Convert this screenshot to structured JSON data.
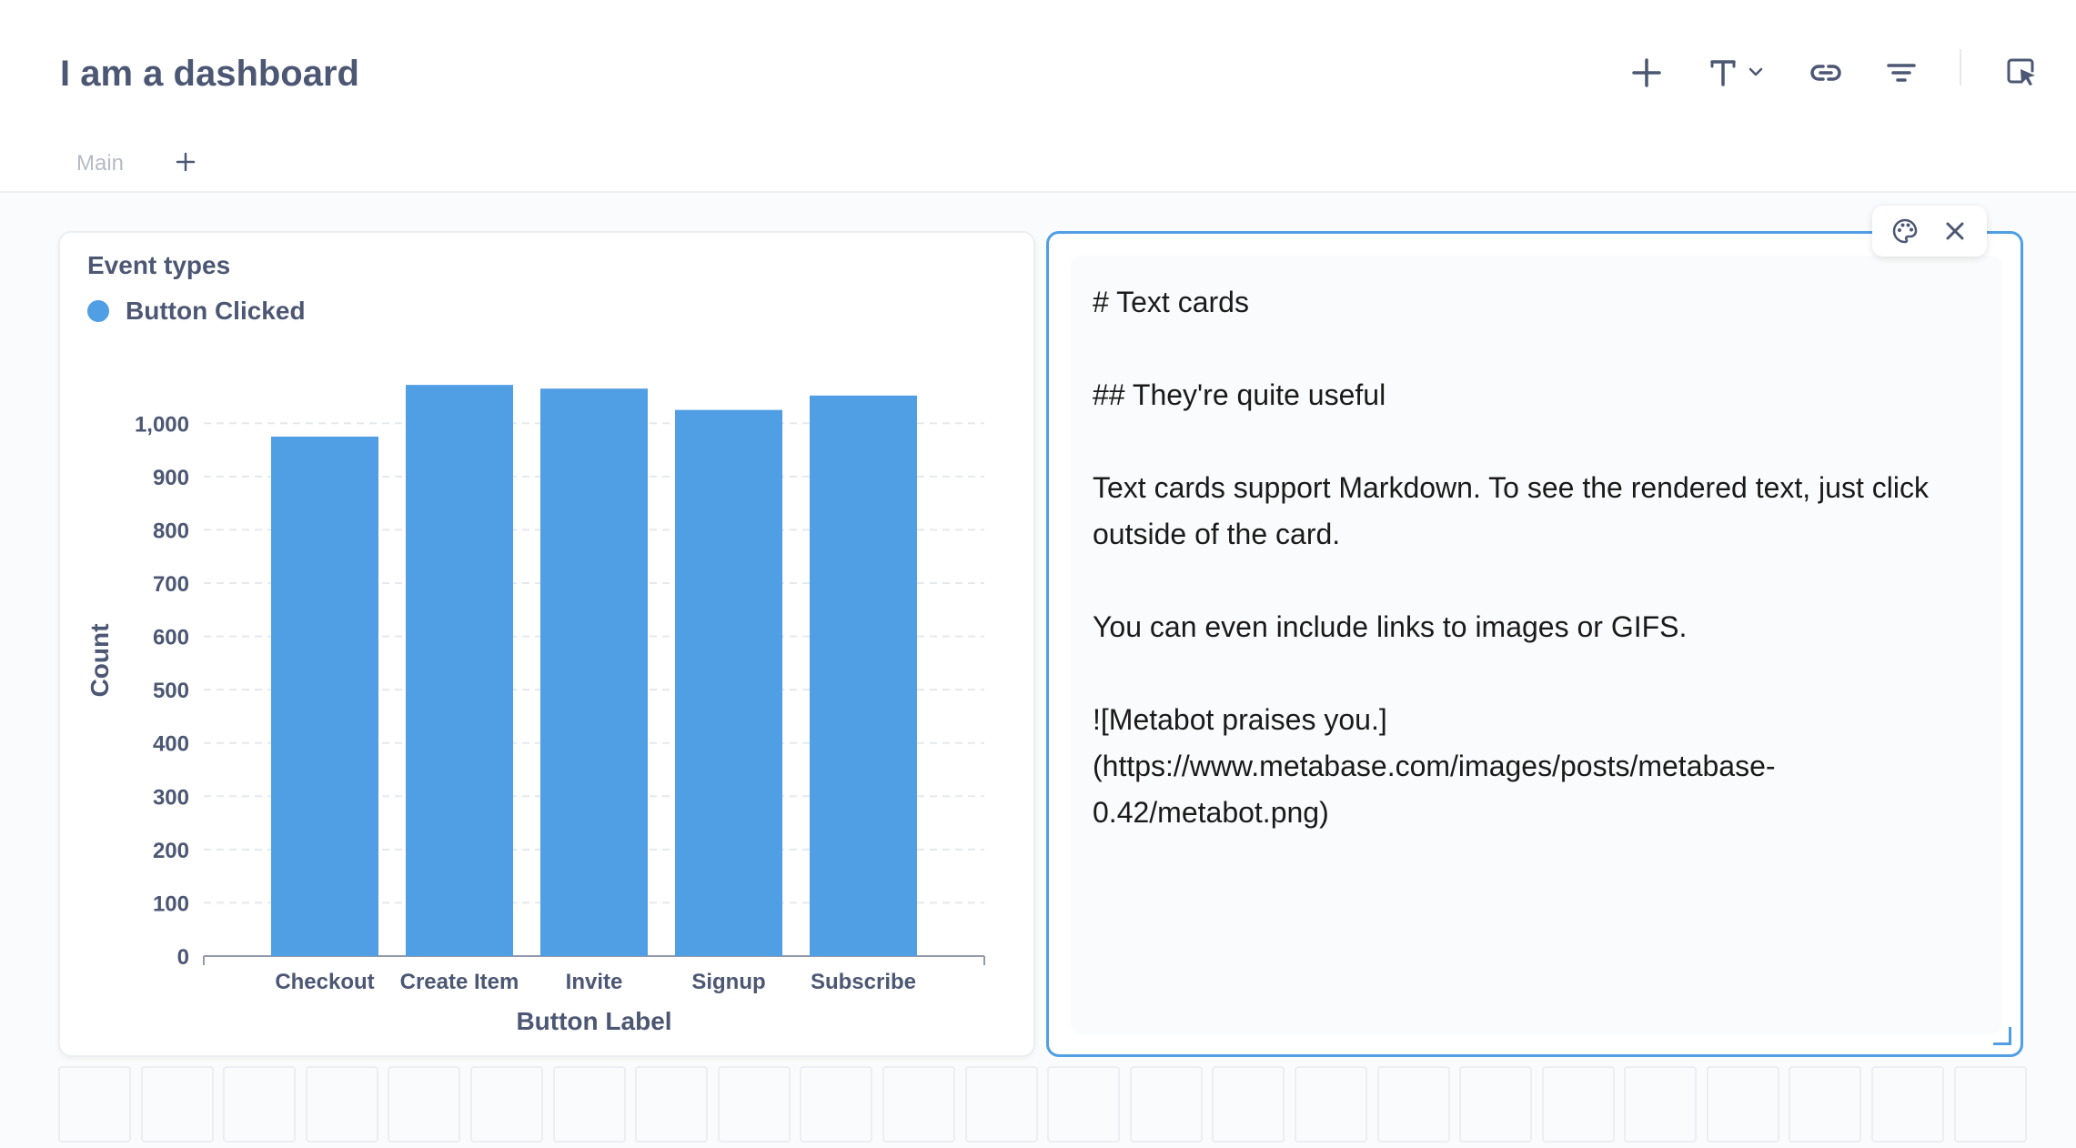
{
  "dashboard": {
    "title": "I am a dashboard"
  },
  "toolbar": {
    "icons": [
      "plus-icon",
      "text-icon",
      "link-icon",
      "filter-icon",
      "edit-selection-icon"
    ]
  },
  "tabs": [
    {
      "label": "Main"
    }
  ],
  "tab_add_label": "+",
  "chart_card": {
    "title": "Event types",
    "legend_label": "Button Clicked",
    "accent_color": "#509ee3"
  },
  "chart_data": {
    "type": "bar",
    "title": "Event types",
    "categories": [
      "Checkout",
      "Create Item",
      "Invite",
      "Signup",
      "Subscribe"
    ],
    "series": [
      {
        "name": "Button Clicked",
        "values": [
          975,
          1072,
          1065,
          1025,
          1052
        ]
      }
    ],
    "xlabel": "Button Label",
    "ylabel": "Count",
    "ylim": [
      0,
      1050
    ],
    "yticks": [
      0,
      100,
      200,
      300,
      400,
      500,
      600,
      700,
      800,
      900,
      1000
    ],
    "ytick_labels": [
      "0",
      "100",
      "200",
      "300",
      "400",
      "500",
      "600",
      "700",
      "800",
      "900",
      "1,000"
    ],
    "grid": true,
    "legend_position": "top-left"
  },
  "text_card": {
    "content": "# Text cards\n\n## They're quite useful\n\nText cards support Markdown. To see the rendered text, just click outside of the card.\n\nYou can even include links to images or GIFS.\n\n![Metabot praises you.](https://www.metabase.com/images/posts/metabase-0.42/metabot.png)",
    "action_icons": [
      "palette-icon",
      "close-icon"
    ]
  },
  "colors": {
    "accent": "#509ee3",
    "text_primary": "#4c5773",
    "text_muted": "#b5bac4"
  }
}
